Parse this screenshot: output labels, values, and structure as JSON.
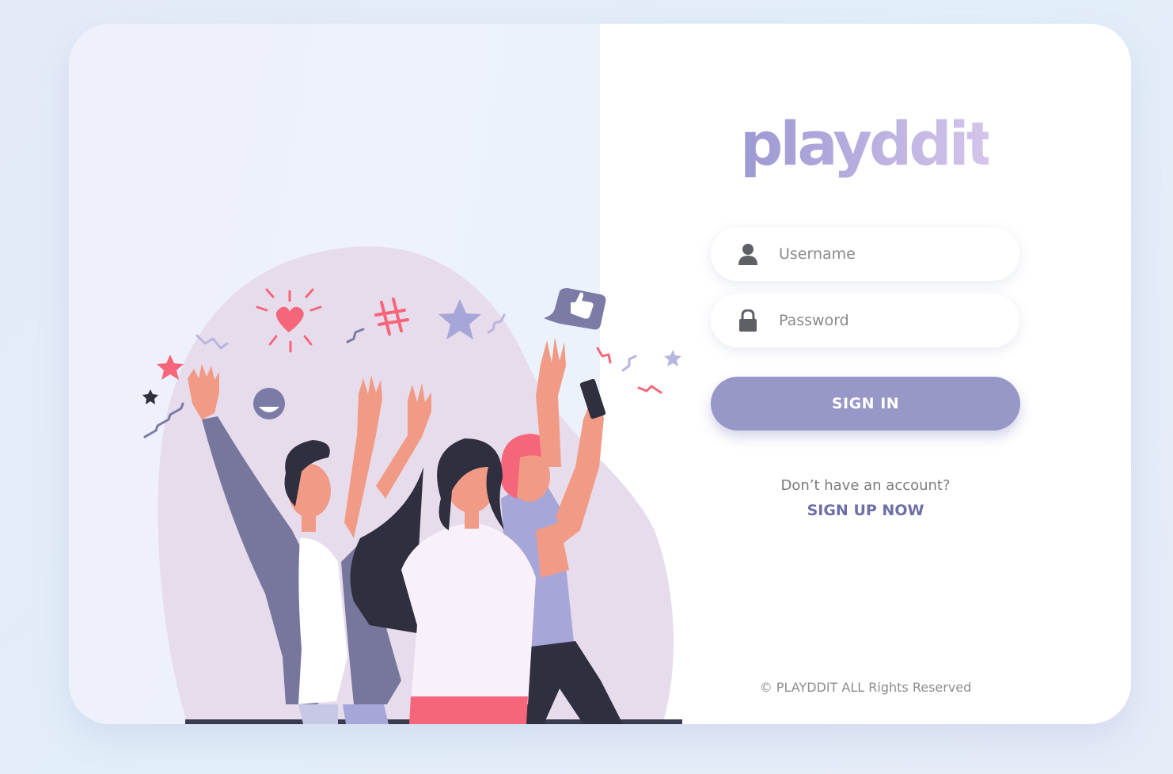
{
  "brand": {
    "logo_text": "playddit"
  },
  "login": {
    "username_placeholder": "Username",
    "password_placeholder": "Password",
    "signin_label": "SIGN IN",
    "no_account_text": "Don’t have an account?",
    "signup_label": "SIGN UP NOW"
  },
  "footer": {
    "copyright": "© PLAYDDIT ALL Rights Reserved"
  },
  "icons": {
    "username": "user-icon",
    "password": "lock-icon"
  },
  "colors": {
    "accent": "#9797c8",
    "link": "#6e6ea8",
    "logo_gradient_start": "#9c98d2",
    "logo_gradient_end": "#d6c6ec"
  }
}
